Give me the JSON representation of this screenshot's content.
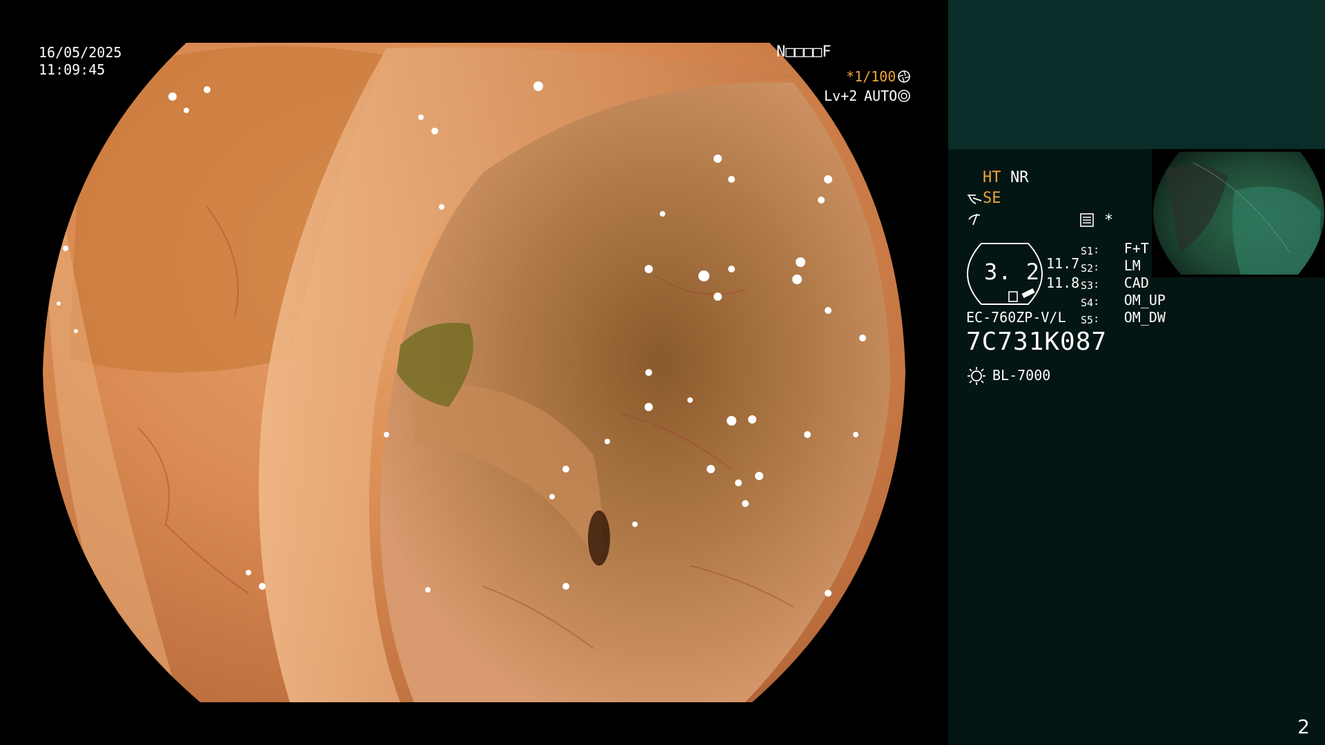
{
  "overlay": {
    "date": "16/05/2025",
    "time": "11:09:45",
    "mode_code": "N□□□□F",
    "shutter": "*1/100",
    "shutter_icon": "aperture-icon",
    "level": "Lv+2",
    "iris": "AUTO",
    "iris_icon": "iris-icon"
  },
  "panel": {
    "ht_label": "HT",
    "nr_label": "NR",
    "se_label": "SE",
    "se_icon": "enhance-icon",
    "freeze_icon": "freeze-icon",
    "memory_icon": "memory-card-icon",
    "star": "*",
    "scope_value": "3. 2",
    "val1": "11.7",
    "val2": "11.8",
    "switches": [
      {
        "key": "S1",
        "value": "F+T"
      },
      {
        "key": "S2",
        "value": "LM"
      },
      {
        "key": "S3",
        "value": "CAD"
      },
      {
        "key": "S4",
        "value": "OM_UP"
      },
      {
        "key": "S5",
        "value": "OM_DW"
      }
    ],
    "scope_model": "EC-760ZP-V/L",
    "serial": "7C731K087",
    "light_source": "BL-7000",
    "light_icon": "light-source-icon",
    "page_number": "2"
  },
  "colors": {
    "panel_bg": "#041614",
    "panel_top_bg": "#0b2d29",
    "accent_orange": "#f0a43a",
    "tissue_base": "#d98a52"
  }
}
